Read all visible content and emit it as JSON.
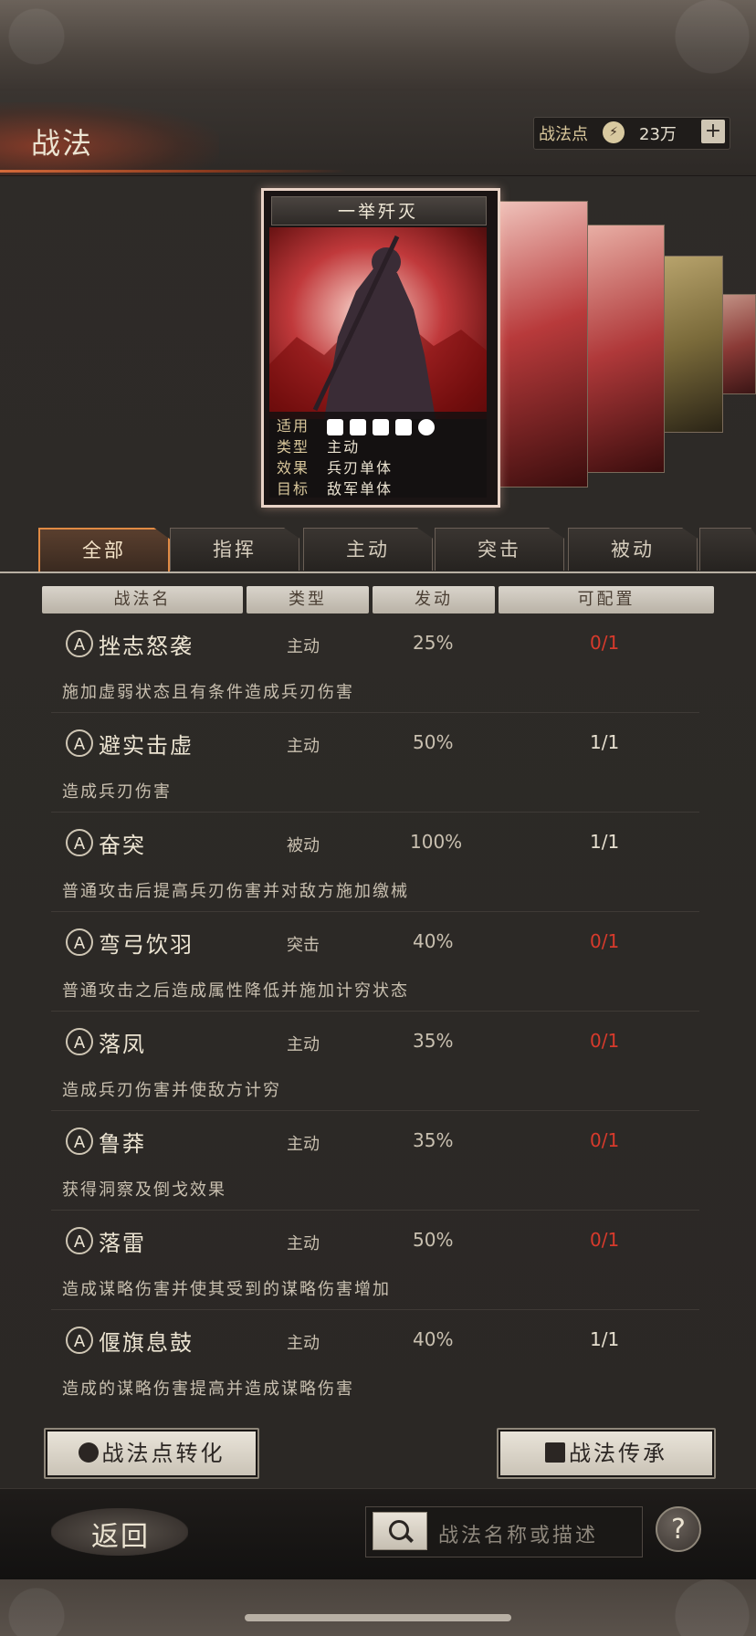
{
  "header": {
    "title": "战法",
    "points_label": "战法点",
    "points_icon": "zhanfa-point-icon",
    "points_value": "23万",
    "plus_label": "+"
  },
  "card": {
    "title": "一举歼灭",
    "info": [
      {
        "key": "适用",
        "value": ""
      },
      {
        "key": "类型",
        "value": "主动"
      },
      {
        "key": "效果",
        "value": "兵刃单体"
      },
      {
        "key": "目标",
        "value": "敌军单体"
      }
    ],
    "applicable_icons": [
      "cavalry-icon",
      "shield-icon",
      "bow-icon",
      "spear-icon",
      "chariot-icon"
    ]
  },
  "tabs": [
    "全部",
    "指挥",
    "主动",
    "突击",
    "被动"
  ],
  "active_tab": "全部",
  "table": {
    "headers": [
      "战法名",
      "类型",
      "发动",
      "可配置"
    ]
  },
  "skills": [
    {
      "grade": "A",
      "name": "挫志怒袭",
      "type": "主动",
      "rate": "25%",
      "config": "0/1",
      "desc": "施加虚弱状态且有条件造成兵刃伤害"
    },
    {
      "grade": "A",
      "name": "避实击虚",
      "type": "主动",
      "rate": "50%",
      "config": "1/1",
      "desc": "造成兵刃伤害"
    },
    {
      "grade": "A",
      "name": "奋突",
      "type": "被动",
      "rate": "100%",
      "config": "1/1",
      "desc": "普通攻击后提高兵刃伤害并对敌方施加缴械"
    },
    {
      "grade": "A",
      "name": "弯弓饮羽",
      "type": "突击",
      "rate": "40%",
      "config": "0/1",
      "desc": "普通攻击之后造成属性降低并施加计穷状态"
    },
    {
      "grade": "A",
      "name": "落凤",
      "type": "主动",
      "rate": "35%",
      "config": "0/1",
      "desc": "造成兵刃伤害并使敌方计穷"
    },
    {
      "grade": "A",
      "name": "鲁莽",
      "type": "主动",
      "rate": "35%",
      "config": "0/1",
      "desc": "获得洞察及倒戈效果"
    },
    {
      "grade": "A",
      "name": "落雷",
      "type": "主动",
      "rate": "50%",
      "config": "0/1",
      "desc": "造成谋略伤害并使其受到的谋略伤害增加"
    },
    {
      "grade": "A",
      "name": "偃旗息鼓",
      "type": "主动",
      "rate": "40%",
      "config": "1/1",
      "desc": "造成的谋略伤害提高并造成谋略伤害"
    }
  ],
  "buttons": {
    "convert_label": "战法点转化",
    "inherit_label": "战法传承"
  },
  "bottom": {
    "back_label": "返回",
    "search_placeholder": "战法名称或描述",
    "help_label": "?"
  },
  "colors": {
    "accent": "#e08a44",
    "unavailable": "#d73a2c"
  }
}
